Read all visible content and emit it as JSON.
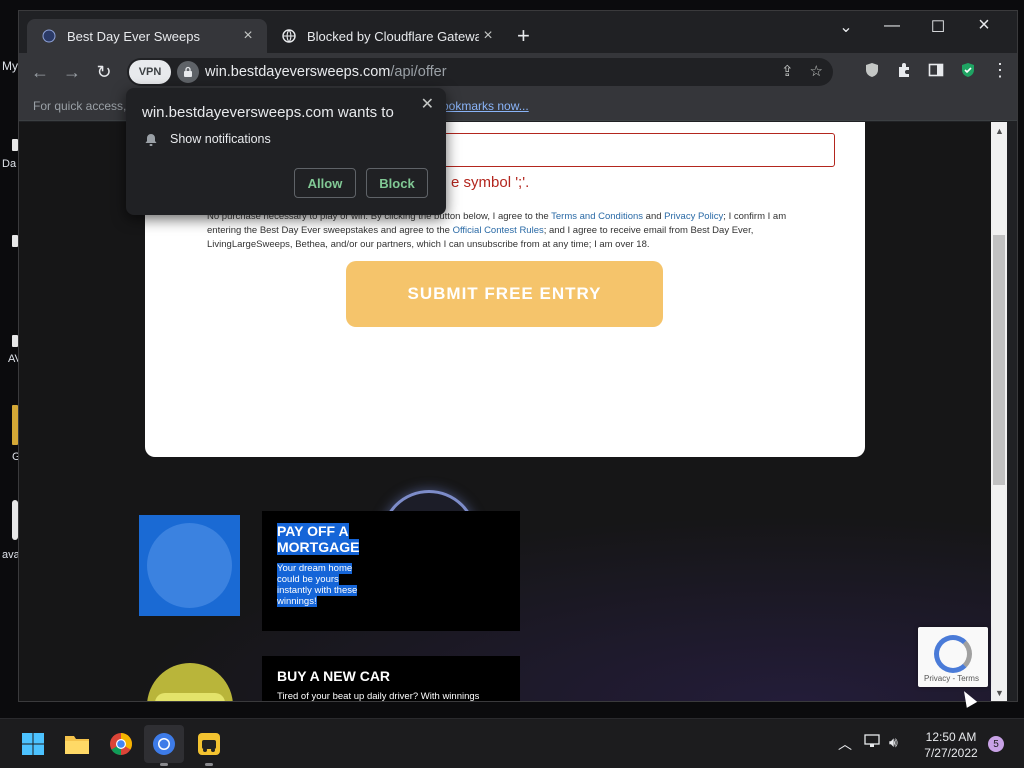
{
  "desktop": {
    "labels": [
      "My",
      "Da",
      "AV",
      "G",
      "ava"
    ]
  },
  "tabs": [
    {
      "title": "Best Day Ever Sweeps",
      "active": true,
      "icon": "site-logo-icon"
    },
    {
      "title": "Blocked by Cloudflare Gateway",
      "active": false,
      "icon": "globe-icon"
    }
  ],
  "toolbar": {
    "vpn_label": "VPN",
    "url_host": "win.bestdayeversweeps.com",
    "url_path": "/api/offer"
  },
  "bookmarks": {
    "hint_left": "For quick access, p",
    "hint_link": "ookmarks now..."
  },
  "page": {
    "error_text": "e symbol ';'.",
    "legal": {
      "p1": "No purchase necessary to play or win. By clicking the button below, I agree to the ",
      "terms": "Terms and Conditions",
      "and": " and ",
      "privacy": "Privacy Policy",
      "p2": "; I confirm I am entering the Best Day Ever sweepstakes and agree to the ",
      "rules": "Official Contest Rules",
      "p3": "; and I agree to receive email from Best Day Ever, LivingLargeSweeps, Bethea, and/or our partners, which I can unsubscribe from at any time; I am over 18."
    },
    "submit_label": "SUBMIT FREE ENTRY",
    "promos": [
      {
        "title_line1": "PAY OFF A",
        "title_line2": "MORTGAGE",
        "body": "Your dream home could be yours instantly with these winnings!"
      },
      {
        "title": "BUY A NEW CAR",
        "body": "Tired of your beat up daily driver? With winnings"
      }
    ],
    "recaptcha_links": "Privacy - Terms"
  },
  "permission_popup": {
    "title": "win.bestdayeversweeps.com wants to",
    "item": "Show notifications",
    "allow": "Allow",
    "block": "Block"
  },
  "taskbar": {
    "time": "12:50 AM",
    "date": "7/27/2022",
    "notification_count": "5"
  },
  "colors": {
    "submit_bg": "#f5c46b",
    "error_red": "#b3261e",
    "selection_blue": "#1565d8",
    "link_blue": "#8ab4f8"
  }
}
